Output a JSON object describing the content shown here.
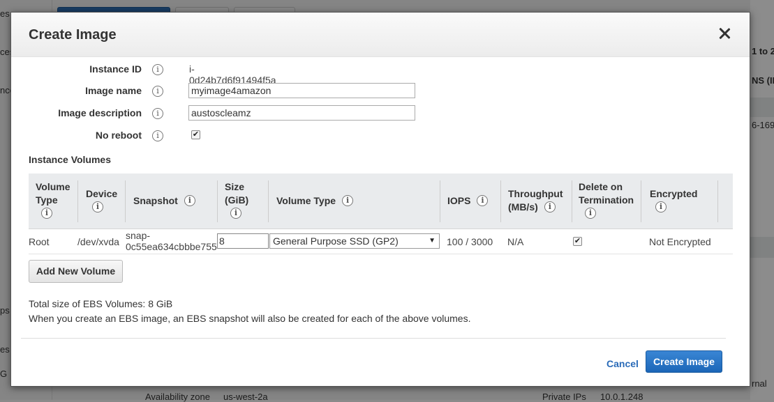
{
  "background": {
    "left_fragments": [
      "es",
      "ces",
      "nce",
      "ps",
      "es",
      "G"
    ],
    "right_fragments": [
      "1 to 2",
      "NS (IP",
      "6-169",
      "rnal"
    ],
    "bottom_fragments": [
      "Availability zone",
      "us-west-2a",
      "Private IPs",
      "10.0.1.248"
    ]
  },
  "modal": {
    "title": "Create Image",
    "fields": {
      "instance_id": {
        "label": "Instance ID",
        "value": "i-0d24b7d6f91494f5a"
      },
      "image_name": {
        "label": "Image name",
        "value": "myimage4amazon"
      },
      "image_description": {
        "label": "Image description",
        "value": "austoscleamz"
      },
      "no_reboot": {
        "label": "No reboot",
        "checked": true
      }
    },
    "volumes": {
      "section_title": "Instance Volumes",
      "headers": {
        "volume_type_1": "Volume",
        "volume_type_2": "Type",
        "device": "Device",
        "snapshot": "Snapshot",
        "size_1": "Size",
        "size_2": "(GiB)",
        "volume_type": "Volume Type",
        "iops": "IOPS",
        "throughput_1": "Throughput",
        "throughput_2": "(MB/s)",
        "delete_1": "Delete on",
        "delete_2": "Termination",
        "encrypted": "Encrypted"
      },
      "rows": [
        {
          "volume_type": "Root",
          "device": "/dev/xvda",
          "snapshot_1": "snap-",
          "snapshot_2": "0c55ea634cbbbe755",
          "size": "8",
          "ebs_type": "General Purpose SSD (GP2)",
          "iops": "100 / 3000",
          "throughput": "N/A",
          "delete_on_termination": true,
          "encrypted": "Not Encrypted"
        }
      ],
      "add_button": "Add New Volume"
    },
    "total_size": "Total size of EBS Volumes: 8 GiB",
    "note": "When you create an EBS image, an EBS snapshot will also be created for each of the above volumes.",
    "cancel_label": "Cancel",
    "create_label": "Create Image"
  },
  "icons": {
    "info": "i",
    "check": "✔",
    "dropdown": "▼"
  },
  "colors": {
    "primary_button": "#1f6bb9",
    "link": "#2a6bb8",
    "header_bg": "#e9ebed"
  }
}
